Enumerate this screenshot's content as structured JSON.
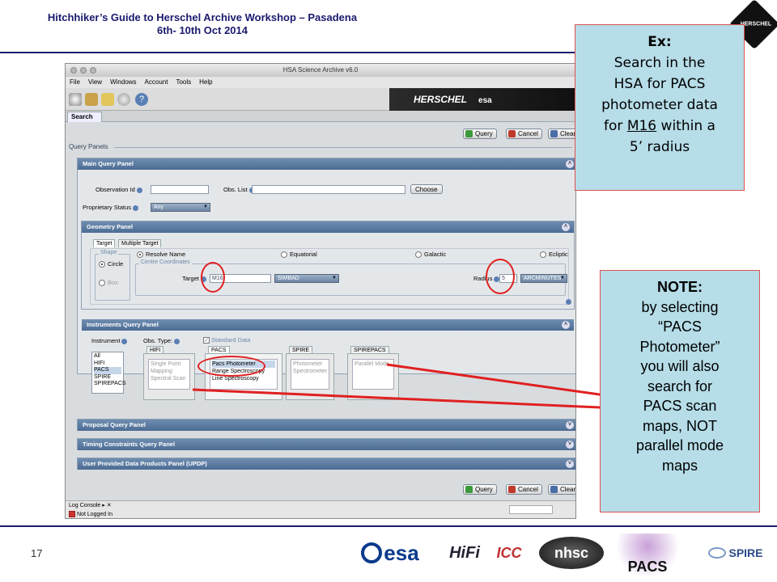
{
  "slide": {
    "title_line1": "Hitchhiker’s Guide to Herschel Archive Workshop – Pasadena",
    "title_line2": "6th- 10th Oct 2014",
    "page_number": "17"
  },
  "app": {
    "window_title": "HSA Science Archive v6.0",
    "menu": [
      "File",
      "View",
      "Windows",
      "Account",
      "Tools",
      "Help"
    ],
    "banner_text": "HERSCHEL",
    "banner_esa": "esa",
    "tab_label": "Search",
    "query_panels_label": "Query  Panels",
    "buttons": {
      "query": "Query",
      "cancel": "Cancel",
      "clear": "Clear"
    },
    "main_panel": {
      "title": "Main  Query  Panel",
      "observation_id_label": "Observation  Id",
      "obs_list_label": "Obs.  List",
      "choose_label": "Choose",
      "proprietary_label": "Proprietary  Status",
      "proprietary_value": "Any"
    },
    "geometry_panel": {
      "title": "Geometry  Panel",
      "tabs": [
        "Target",
        "Multiple Target"
      ],
      "shape_label": "Shape",
      "shape_circle": "Circle",
      "shape_box": "Box",
      "resolve_name": "Resolve Name",
      "equatorial": "Equatorial",
      "galactic": "Galactic",
      "ecliptic": "Ecliptic",
      "centre_coords": "Centre  Coordinates",
      "target_label": "Target",
      "target_value": "M16",
      "resolver": "SIMBAD",
      "radius_label": "Radius",
      "radius_value": "5",
      "radius_unit": "ARCMINUTES"
    },
    "instruments_panel": {
      "title": "Instruments  Query  Panel",
      "instrument_label": "Instrument",
      "obs_type_label": "Obs.  Type:",
      "standard_data": "Standard  Data",
      "instrument_list": [
        "All",
        "HIFI",
        "PACS",
        "SPIRE",
        "SPIREPACS"
      ],
      "hifi_tab": "HIFI",
      "hifi_modes": [
        "Single Point",
        "Mapping",
        "Spectral Scan"
      ],
      "pacs_tab": "PACS",
      "pacs_modes": [
        "Pacs Photometer",
        "Range Spectroscopy",
        "Line Spectroscopy"
      ],
      "spire_tab": "SPIRE",
      "spire_modes": [
        "Photometer",
        "Spectrometer"
      ],
      "spirepacs_tab": "SPIREPACS",
      "spirepacs_modes": [
        "Parallel Mode"
      ]
    },
    "collapsed_panels": [
      "Proposal  Query  Panel",
      "Timing Constraints  Query Panel",
      "User Provided Data Products Panel (UPDP)"
    ],
    "log_console": "Log Console",
    "status": "Not Logged In"
  },
  "callouts": {
    "ex_heading": "Ex:",
    "ex_lines": [
      "Search in the",
      "HSA for PACS",
      "photometer data"
    ],
    "ex_for": "for",
    "ex_target": "M16",
    "ex_within": "within a",
    "ex_last": "5’ radius",
    "note_heading": "NOTE:",
    "note_lines": [
      "by selecting",
      "“PACS",
      "Photometer”",
      "you will also",
      "search for",
      "PACS scan",
      "maps, NOT",
      "parallel mode",
      "maps"
    ]
  },
  "footer_logos": {
    "esa": "esa",
    "hifi": "HiFi",
    "icc": "ICC",
    "nhsc": "nhsc",
    "pacs": "PACS",
    "spire": "SPIRE"
  },
  "colors": {
    "callout_fill": "#b6dde8",
    "callout_border": "#e05050",
    "highlight_red": "#e02020",
    "panel_header": "#4c6c94",
    "title_blue": "#1a1a6e"
  }
}
